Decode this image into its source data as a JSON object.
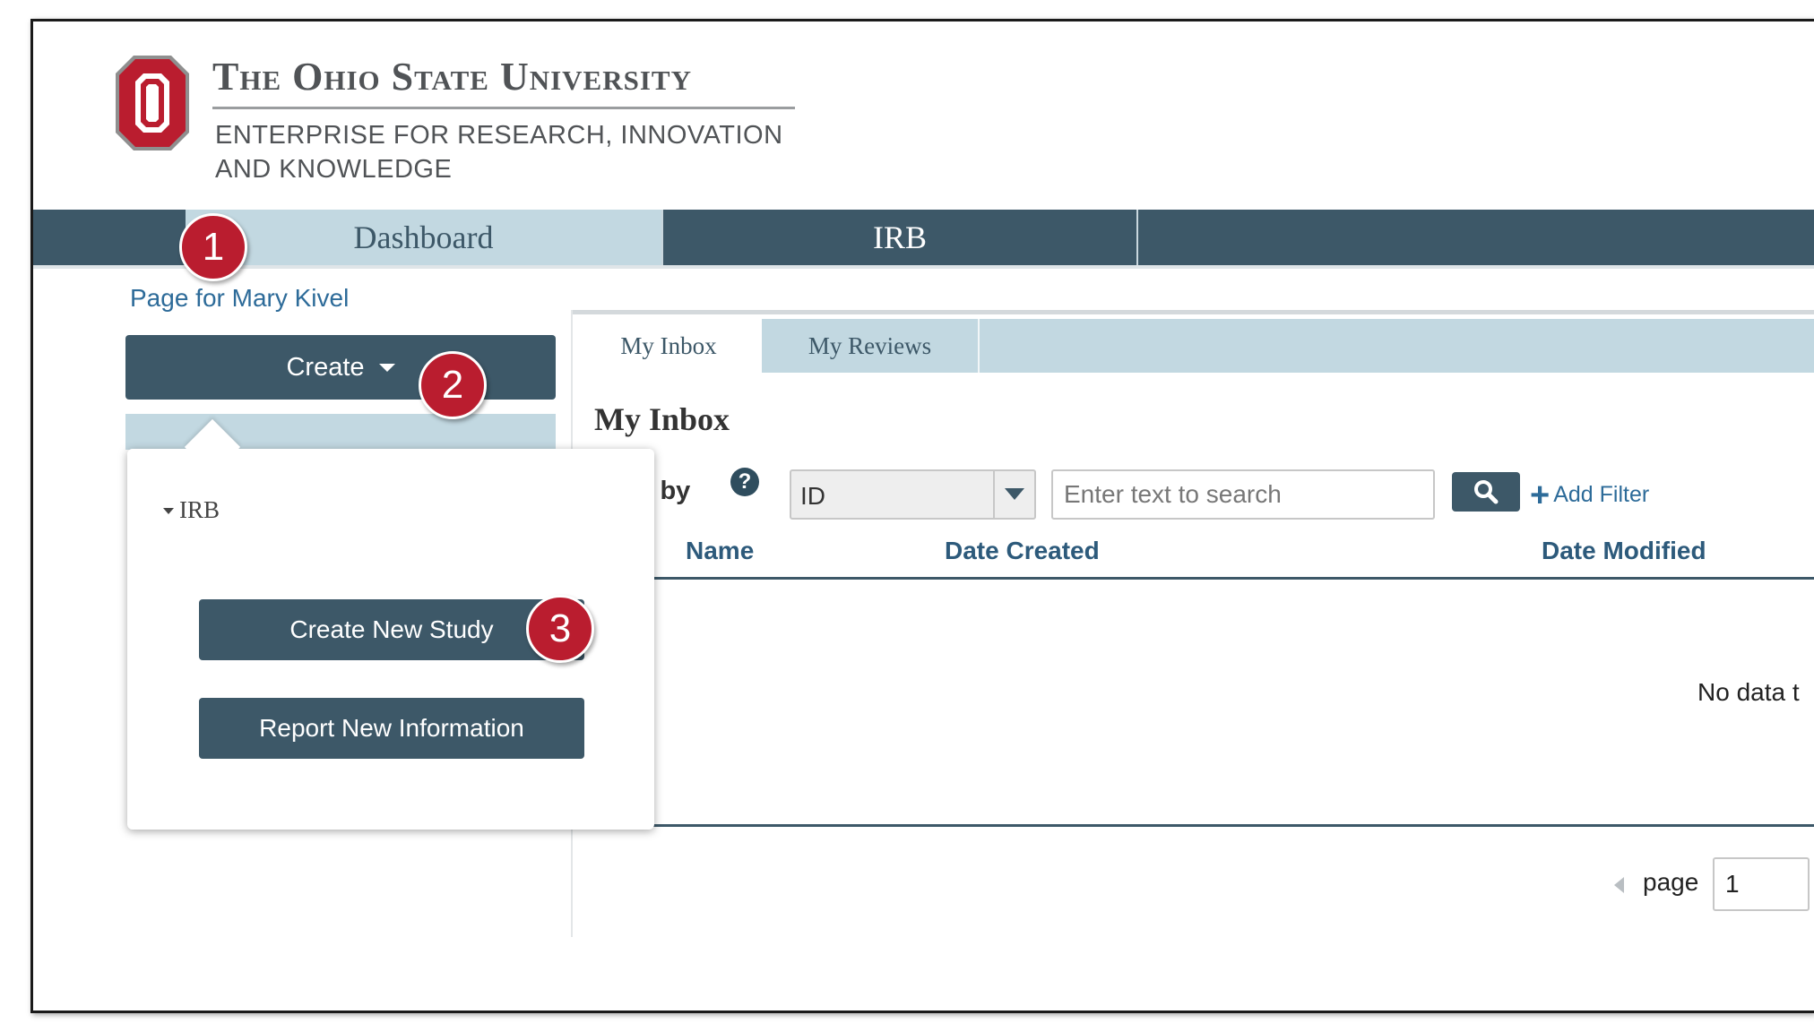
{
  "header": {
    "university_name": "The Ohio State University",
    "subtitle_line1": "ENTERPRISE FOR RESEARCH, INNOVATION",
    "subtitle_line2": "AND KNOWLEDGE",
    "brand_color": "#ba1d2f"
  },
  "nav": {
    "tabs": [
      {
        "label": "Dashboard",
        "active": true
      },
      {
        "label": "IRB",
        "active": false
      }
    ],
    "bar_color": "#3d5868",
    "active_color": "#c2d8e1"
  },
  "sidebar": {
    "page_for": "Page for Mary Kivel",
    "create_label": "Create"
  },
  "create_menu": {
    "group_label": "IRB",
    "items": [
      {
        "label": "Create New Study"
      },
      {
        "label": "Report New Information"
      }
    ]
  },
  "main": {
    "tabs": [
      {
        "label": "My Inbox",
        "active": true
      },
      {
        "label": "My Reviews",
        "active": false
      }
    ],
    "title": "My Inbox",
    "filter_label": "er by",
    "filter_select_value": "ID",
    "search_placeholder": "Enter text to search",
    "add_filter_label": "Add Filter",
    "columns": [
      "Name",
      "Date Created",
      "Date Modified"
    ],
    "empty_text": "No data t",
    "pager_label": "page",
    "pager_value": "1"
  },
  "callouts": [
    "1",
    "2",
    "3"
  ],
  "icons": {
    "search": "magnifier-icon",
    "help": "question-circle-icon",
    "add": "plus-icon"
  }
}
